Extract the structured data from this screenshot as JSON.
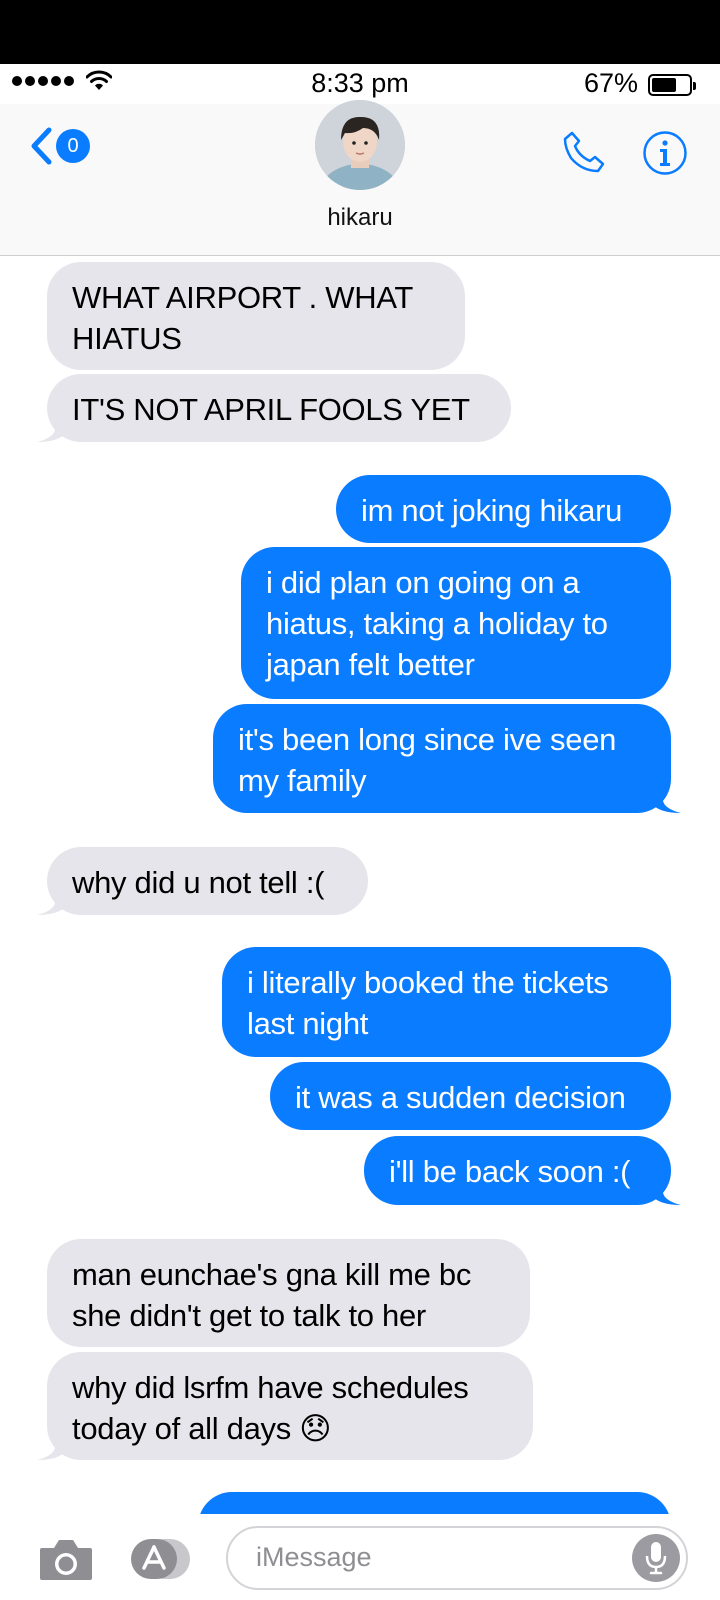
{
  "status_bar": {
    "time": "8:33 pm",
    "battery": "67%",
    "signal_bars": 5
  },
  "header": {
    "back_badge": "0",
    "contact_name": "hikaru",
    "icons": [
      "back-chevron-icon",
      "avatar",
      "phone-icon",
      "info-icon"
    ]
  },
  "messages": [
    {
      "from": "them",
      "text": "WHAT AIRPORT . WHAT HIATUS"
    },
    {
      "from": "them",
      "text": "IT'S NOT APRIL FOOLS YET"
    },
    {
      "from": "me",
      "text": "im not joking hikaru"
    },
    {
      "from": "me",
      "text": "i did plan on going on a hiatus, taking a holiday to japan felt better"
    },
    {
      "from": "me",
      "text": "it's been long since ive seen my family"
    },
    {
      "from": "them",
      "text": "why did u not tell :("
    },
    {
      "from": "me",
      "text": "i literally booked the tickets last night"
    },
    {
      "from": "me",
      "text": "it was a sudden decision"
    },
    {
      "from": "me",
      "text": "i'll be back soon :("
    },
    {
      "from": "them",
      "text": "man eunchae's gna kill me bc she didn't get to talk to her"
    },
    {
      "from": "them",
      "text": "why did lsrfm have schedules today of all days 😞"
    }
  ],
  "composer": {
    "placeholder": "iMessage",
    "icons": [
      "camera-icon",
      "app-store-icon",
      "microphone-icon"
    ]
  },
  "colors": {
    "outgoing": "#0a7cff",
    "incoming": "#e6e5eb",
    "accent": "#0a7cff"
  }
}
